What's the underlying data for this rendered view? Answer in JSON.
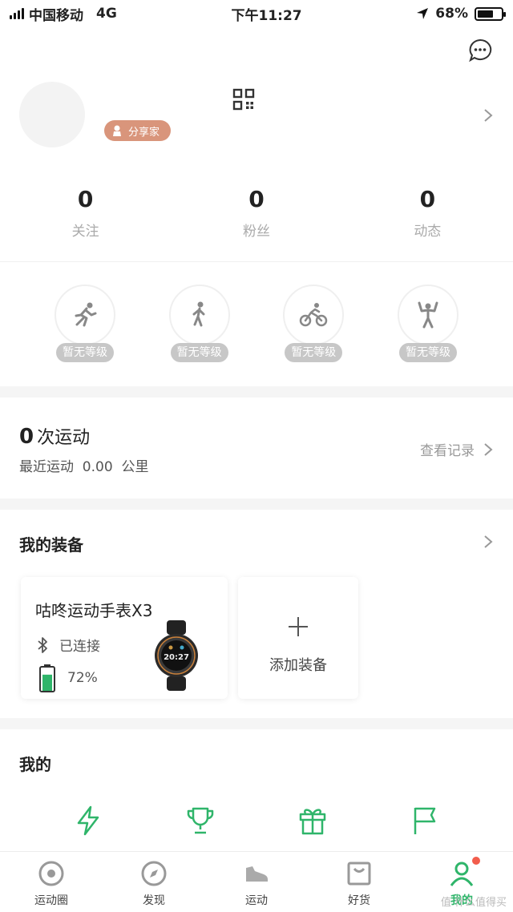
{
  "status_bar": {
    "carrier": "中国移动",
    "network": "4G",
    "time": "下午11:27",
    "battery_pct": "68%",
    "battery_level": 0.68
  },
  "profile": {
    "name": "",
    "badge": "分享家"
  },
  "stats": [
    {
      "value": "0",
      "label": "关注"
    },
    {
      "value": "0",
      "label": "粉丝"
    },
    {
      "value": "0",
      "label": "动态"
    }
  ],
  "levels": [
    {
      "icon": "running-icon",
      "tag": "暂无等级"
    },
    {
      "icon": "walking-icon",
      "tag": "暂无等级"
    },
    {
      "icon": "cycling-icon",
      "tag": "暂无等级"
    },
    {
      "icon": "fitness-icon",
      "tag": "暂无等级"
    }
  ],
  "workout": {
    "count": "0",
    "count_suffix": "次运动",
    "recent": "最近运动  0.00  公里",
    "view_records": "查看记录"
  },
  "gear": {
    "title": "我的装备",
    "device": {
      "name": "咕咚运动手表X3",
      "status": "已连接",
      "battery": "72%",
      "battery_level": 0.72,
      "watch_face_time": "20:27"
    },
    "add_label": "添加装备"
  },
  "mine": {
    "title": "我的",
    "icons": [
      "lightning-icon",
      "trophy-icon",
      "gift-icon",
      "flag-icon"
    ]
  },
  "tabs": [
    {
      "label": "运动圈",
      "icon": "circle-target-icon",
      "active": false
    },
    {
      "label": "发现",
      "icon": "compass-icon",
      "active": false
    },
    {
      "label": "运动",
      "icon": "shoe-icon",
      "active": false
    },
    {
      "label": "好货",
      "icon": "shopping-bag-icon",
      "active": false
    },
    {
      "label": "我的",
      "icon": "profile-icon",
      "active": true
    }
  ],
  "watermark": "值 什么值得买",
  "colors": {
    "accent": "#2fb56a",
    "badge": "#d9957b",
    "level_tag": "#c7c7c7",
    "notification": "#f25d4c"
  }
}
